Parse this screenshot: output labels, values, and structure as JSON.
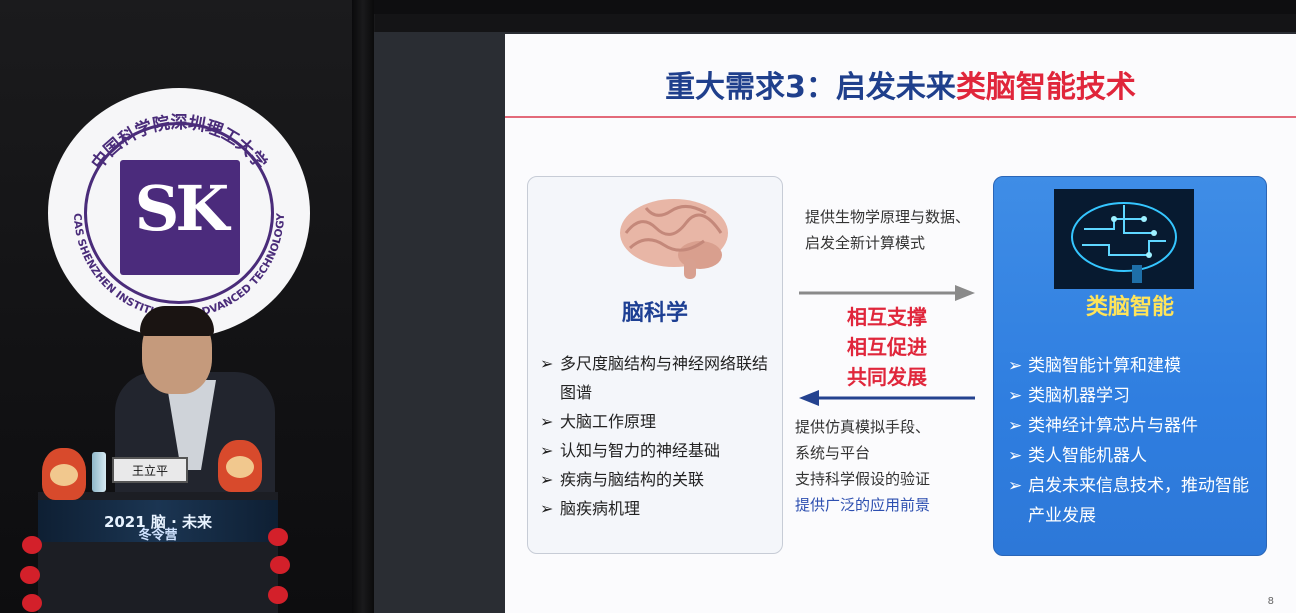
{
  "slide": {
    "title_main": "重大需求3：启发未来",
    "title_accent": "类脑智能技术",
    "page_number": "8",
    "left_panel": {
      "title": "脑科学",
      "items": [
        "多尺度脑结构与神经网络联结图谱",
        "大脑工作原理",
        "认知与智力的神经基础",
        "疾病与脑结构的关联",
        "脑疾病机理"
      ]
    },
    "middle": {
      "top_text": "提供生物学原理与数据、启发全新计算模式",
      "center_lines": [
        "相互支撑",
        "相互促进",
        "共同发展"
      ],
      "bottom_lines": [
        "提供仿真模拟手段、",
        "系统与平台",
        "支持科学假设的验证"
      ],
      "bottom_blue_line": "提供广泛的应用前景"
    },
    "right_panel": {
      "title": "类脑智能",
      "items": [
        "类脑智能计算和建模",
        "类脑机器学习",
        "类神经计算芯片与器件",
        "类人智能机器人",
        "启发未来信息技术，推动智能产业发展"
      ]
    },
    "bullet_symbol": "➢"
  },
  "stage": {
    "logo_cn": "中国科学院深圳理工大学",
    "logo_en": "CAS SHENZHEN INSTITUTE OF ADVANCED TECHNOLOGY",
    "logo_mark": "SK",
    "nameplate": "王立平",
    "banner_main": "2021 脑 · 未来",
    "banner_sub": "冬令营"
  },
  "colors": {
    "title_blue": "#1f3f8c",
    "accent_red": "#e0263b",
    "right_panel_blue": "#2f7ee0",
    "right_title_yellow": "#ffe45a"
  }
}
